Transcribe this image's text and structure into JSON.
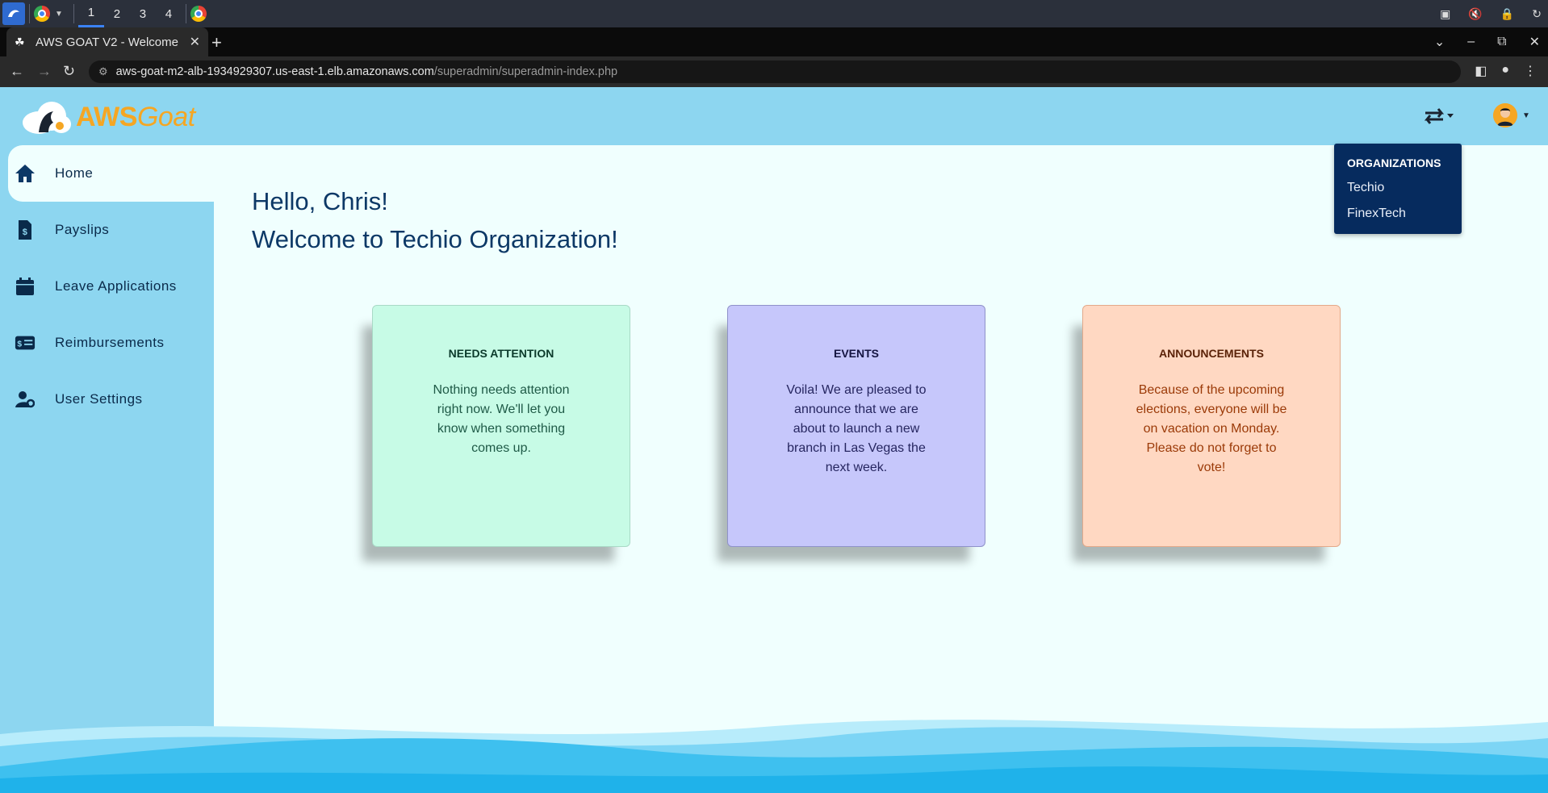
{
  "os": {
    "workspaces": [
      "1",
      "2",
      "3",
      "4"
    ]
  },
  "browser": {
    "tab_title": "AWS GOAT V2 - Welcome",
    "url_host": "aws-goat-m2-alb-1934929307.us-east-1.elb.amazonaws.com",
    "url_path": "/superadmin/superadmin-index.php"
  },
  "app": {
    "logo_aws": "AWS",
    "logo_goat": "Goat"
  },
  "sidebar": {
    "items": [
      {
        "label": "Home",
        "icon": "home-icon"
      },
      {
        "label": "Payslips",
        "icon": "payslip-icon"
      },
      {
        "label": "Leave Applications",
        "icon": "calendar-icon"
      },
      {
        "label": "Reimbursements",
        "icon": "money-card-icon"
      },
      {
        "label": "User Settings",
        "icon": "user-settings-icon"
      }
    ],
    "active_index": 0
  },
  "main": {
    "greeting": "Hello, Chris!",
    "welcome": "Welcome to Techio Organization!"
  },
  "cards": [
    {
      "title": "NEEDS ATTENTION",
      "body": "Nothing needs attention right now. We'll let you know when something comes up.",
      "bg": "#c7fbe6"
    },
    {
      "title": "EVENTS",
      "body": "Voila! We are pleased to announce that we are about to launch a new branch in Las Vegas the next week.",
      "bg": "#c6c7fb"
    },
    {
      "title": "ANNOUNCEMENTS",
      "body": "Because of the upcoming elections, everyone will be on vacation on Monday. Please do not forget to vote!",
      "bg": "#ffd8c2"
    }
  ],
  "org_menu": {
    "heading": "ORGANIZATIONS",
    "items": [
      "Techio",
      "FinexTech"
    ]
  },
  "colors": {
    "header_bg": "#8dd6f0",
    "main_bg": "#f0fffe",
    "text_primary": "#0c3866",
    "dropdown_bg": "#062b5e",
    "logo_orange": "#f5a623"
  }
}
